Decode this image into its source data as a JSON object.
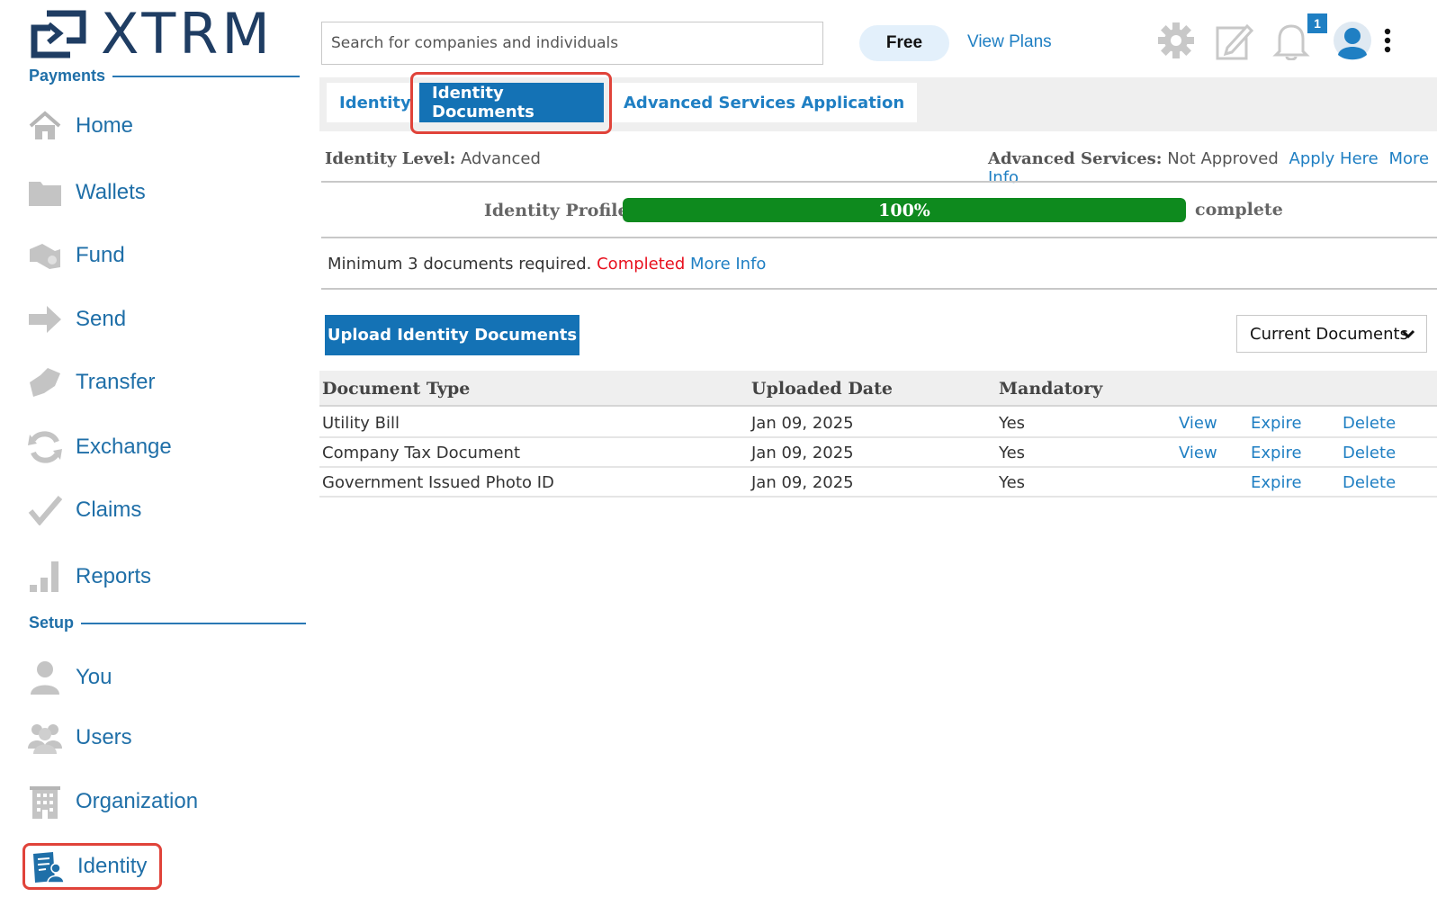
{
  "app": {
    "brand": "XTRM"
  },
  "sidebar": {
    "payments_title": "Payments",
    "setup_title": "Setup",
    "payments_items": [
      {
        "label": "Home",
        "icon": "home-icon"
      },
      {
        "label": "Wallets",
        "icon": "folder-icon"
      },
      {
        "label": "Fund",
        "icon": "hand-money-icon"
      },
      {
        "label": "Send",
        "icon": "arrow-right-icon"
      },
      {
        "label": "Transfer",
        "icon": "transfer-icon"
      },
      {
        "label": "Exchange",
        "icon": "exchange-icon"
      },
      {
        "label": "Claims",
        "icon": "checkmark-icon"
      },
      {
        "label": "Reports",
        "icon": "bar-chart-icon"
      }
    ],
    "setup_items": [
      {
        "label": "You",
        "icon": "user-icon"
      },
      {
        "label": "Users",
        "icon": "users-icon"
      },
      {
        "label": "Organization",
        "icon": "building-icon"
      },
      {
        "label": "Identity",
        "icon": "identity-icon",
        "active": true
      }
    ]
  },
  "header": {
    "search_placeholder": "Search for companies and individuals",
    "plan": "Free",
    "view_plans": "View Plans",
    "notification_count": "1",
    "icons": [
      "gear-icon",
      "edit-icon",
      "bell-icon",
      "avatar-icon",
      "more-vertical-icon"
    ]
  },
  "tabs": [
    {
      "label": "Identity",
      "active": false
    },
    {
      "label": "Identity Documents",
      "active": true
    },
    {
      "label": "Advanced Services Application",
      "active": false
    }
  ],
  "identity": {
    "level_label": "Identity Level:",
    "level_value": "Advanced",
    "adv_label": "Advanced Services:",
    "adv_value": "Not Approved",
    "apply_here": "Apply Here",
    "more_info": "More Info",
    "profile_label": "Identity Profile",
    "profile_percent": 100,
    "profile_percent_text": "100%",
    "complete_text": "complete",
    "requirement_text": "Minimum 3 documents required.",
    "requirement_status": "Completed",
    "requirement_more_info": "More Info"
  },
  "actions": {
    "upload_label": "Upload Identity Documents",
    "filter_selected": "Current Documents"
  },
  "table": {
    "headers": {
      "doc_type": "Document Type",
      "uploaded": "Uploaded Date",
      "mandatory": "Mandatory"
    },
    "rows": [
      {
        "doc_type": "Utility Bill",
        "uploaded": "Jan 09, 2025",
        "mandatory": "Yes",
        "view": "View",
        "expire": "Expire",
        "delete": "Delete"
      },
      {
        "doc_type": "Company Tax Document",
        "uploaded": "Jan 09, 2025",
        "mandatory": "Yes",
        "view": "View",
        "expire": "Expire",
        "delete": "Delete"
      },
      {
        "doc_type": "Government Issued Photo ID",
        "uploaded": "Jan 09, 2025",
        "mandatory": "Yes",
        "view": "",
        "expire": "Expire",
        "delete": "Delete"
      }
    ]
  },
  "colors": {
    "brand": "#1f3d63",
    "link": "#1f7fc3",
    "primary_button": "#1472b5",
    "progress": "#0e8a1e",
    "status_completed": "#e8101e",
    "highlight": "#e0433a"
  }
}
